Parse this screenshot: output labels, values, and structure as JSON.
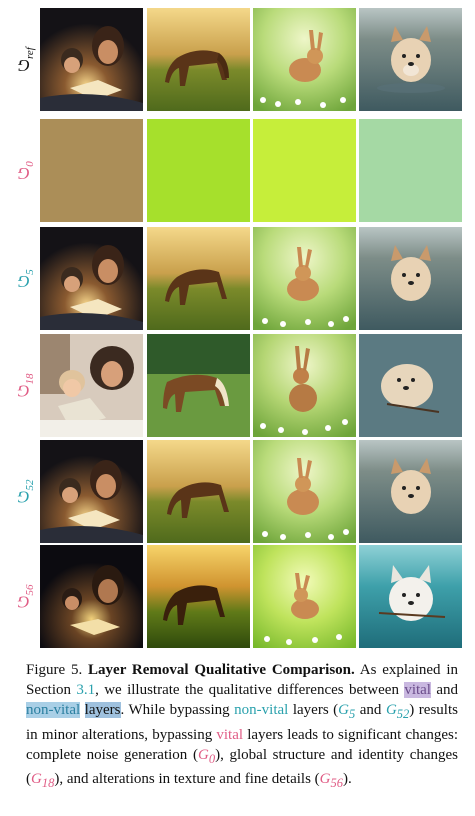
{
  "rows": [
    {
      "label": "G",
      "sub": "ref",
      "color": "#111111"
    },
    {
      "label": "G",
      "sub": "0",
      "color": "#e05c85"
    },
    {
      "label": "G",
      "sub": "5",
      "color": "#2aa1ad"
    },
    {
      "label": "G",
      "sub": "18",
      "color": "#e05c85"
    },
    {
      "label": "G",
      "sub": "52",
      "color": "#2aa1ad"
    },
    {
      "label": "G",
      "sub": "56",
      "color": "#e05c85"
    }
  ],
  "columns": [
    "mother-child-reading",
    "horse-grazing",
    "rabbit-in-flowers",
    "dog-in-water"
  ],
  "caption": {
    "figure": "Figure 5.",
    "title": "Layer Removal Qualitative Comparison.",
    "t1": " As explained in Section ",
    "section_ref": "3.1",
    "t2": ", we illustrate the qualitative differences between ",
    "vital": "vital",
    "and": " and ",
    "non_vital": "non-vital",
    "layers": "layers",
    "t3": ". While bypassing ",
    "t4": " layers (",
    "g5": "G",
    "g5_sub": "5",
    "t5": " and ",
    "g52": "G",
    "g52_sub": "52",
    "t6": ") results in minor alterations, bypassing ",
    "t7": " layers leads to significant changes: complete noise generation (",
    "g0": "G",
    "g0_sub": "0",
    "t8": "), global structure and identity changes (",
    "g18": "G",
    "g18_sub": "18",
    "t9": "), and alterations in texture and fine details (",
    "g56": "G",
    "g56_sub": "56",
    "t10": ")."
  }
}
